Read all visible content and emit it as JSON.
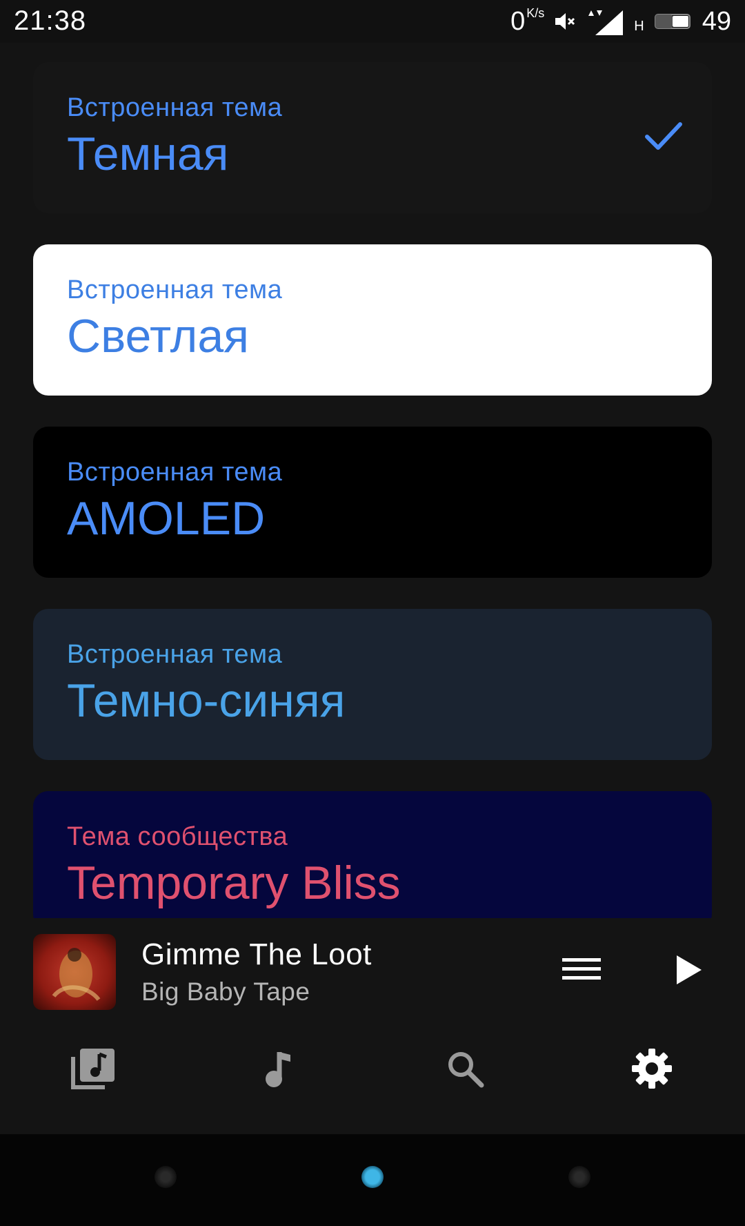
{
  "status_bar": {
    "time": "21:38",
    "speed_value": "0",
    "speed_unit": "K/s",
    "network_letter": "H",
    "battery_percent": "49"
  },
  "themes": [
    {
      "subtitle": "Встроенная тема",
      "title": "Темная",
      "selected": true,
      "background": "#161616",
      "text_color": "#4a8cf7"
    },
    {
      "subtitle": "Встроенная тема",
      "title": "Светлая",
      "selected": false,
      "background": "#ffffff",
      "text_color": "#3d7fe3"
    },
    {
      "subtitle": "Встроенная тема",
      "title": "AMOLED",
      "selected": false,
      "background": "#000000",
      "text_color": "#4a8cf7"
    },
    {
      "subtitle": "Встроенная тема",
      "title": "Темно-синяя",
      "selected": false,
      "background": "#1a2330",
      "text_color": "#4aa3e8"
    },
    {
      "subtitle": "Тема сообщества",
      "title": "Temporary Bliss",
      "selected": false,
      "background": "#05063d",
      "text_color": "#e0516f"
    }
  ],
  "player": {
    "track_title": "Gimme The Loot",
    "artist": "Big Baby Tape",
    "queue_icon": "queue-menu-icon",
    "play_icon": "play-icon"
  },
  "bottom_nav": {
    "items": [
      {
        "icon": "library-icon",
        "active": false
      },
      {
        "icon": "music-note-icon",
        "active": false
      },
      {
        "icon": "search-icon",
        "active": false
      },
      {
        "icon": "gear-icon",
        "active": true
      }
    ]
  },
  "colors": {
    "accent_blue": "#4a8cf7",
    "community_pink": "#e0516f",
    "background": "#141414"
  }
}
